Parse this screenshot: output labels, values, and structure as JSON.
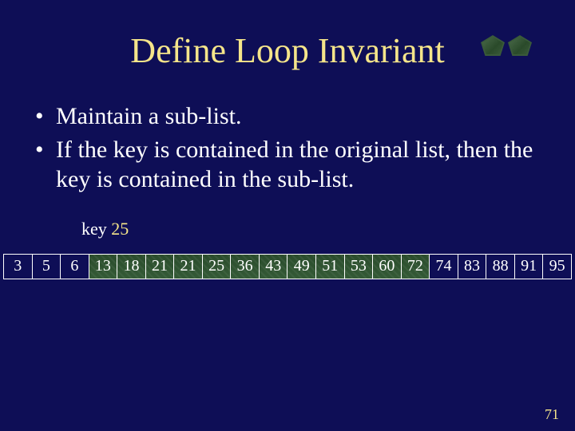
{
  "title": "Define Loop Invariant",
  "bullets": [
    "Maintain a sub-list.",
    "If the key is contained in the original list, then the key is contained in the sub-list."
  ],
  "key": {
    "label": "key",
    "value": "25"
  },
  "array": [
    {
      "v": "3",
      "sub": false
    },
    {
      "v": "5",
      "sub": false
    },
    {
      "v": "6",
      "sub": false
    },
    {
      "v": "13",
      "sub": true
    },
    {
      "v": "18",
      "sub": true
    },
    {
      "v": "21",
      "sub": true
    },
    {
      "v": "21",
      "sub": true
    },
    {
      "v": "25",
      "sub": true
    },
    {
      "v": "36",
      "sub": true
    },
    {
      "v": "43",
      "sub": true
    },
    {
      "v": "49",
      "sub": true
    },
    {
      "v": "51",
      "sub": true
    },
    {
      "v": "53",
      "sub": true
    },
    {
      "v": "60",
      "sub": true
    },
    {
      "v": "72",
      "sub": true
    },
    {
      "v": "74",
      "sub": false
    },
    {
      "v": "83",
      "sub": false
    },
    {
      "v": "88",
      "sub": false
    },
    {
      "v": "91",
      "sub": false
    },
    {
      "v": "95",
      "sub": false
    }
  ],
  "page_number": "71"
}
